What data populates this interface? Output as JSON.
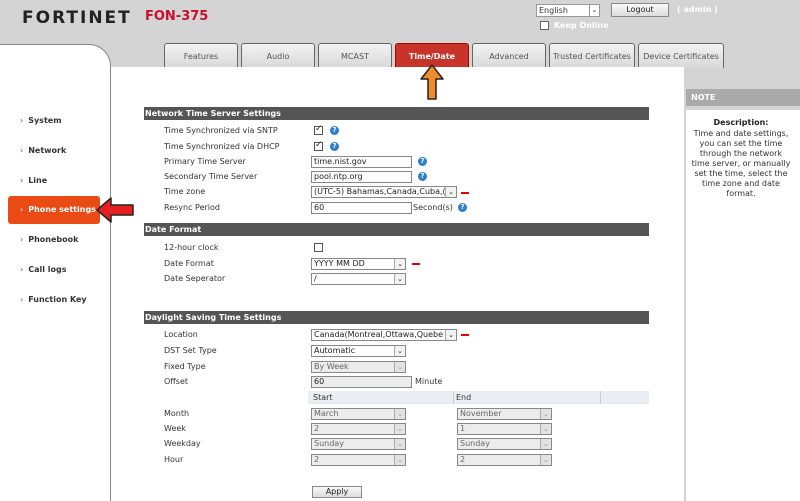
{
  "header": {
    "brand": "FORTINET",
    "model": "FON-375",
    "language": "English",
    "logout_label": "Logout",
    "user": "( admin )",
    "keep_online_label": "Keep Online"
  },
  "tabs": [
    {
      "label": "Features"
    },
    {
      "label": "Audio"
    },
    {
      "label": "MCAST"
    },
    {
      "label": "Time/Date"
    },
    {
      "label": "Advanced"
    },
    {
      "label": "Trusted Certificates"
    },
    {
      "label": "Device Certificates"
    }
  ],
  "sidebar": {
    "items": [
      {
        "label": "System"
      },
      {
        "label": "Network"
      },
      {
        "label": "Line"
      },
      {
        "label": "Phone settings"
      },
      {
        "label": "Phonebook"
      },
      {
        "label": "Call logs"
      },
      {
        "label": "Function Key"
      }
    ]
  },
  "ntp": {
    "title": "Network Time Server Settings",
    "sntp_label": "Time Synchronized via SNTP",
    "dhcp_label": "Time Synchronized via DHCP",
    "primary_label": "Primary Time Server",
    "primary_value": "time.nist.gov",
    "secondary_label": "Secondary Time Server",
    "secondary_value": "pool.ntp.org",
    "tz_label": "Time zone",
    "tz_value": "(UTC-5) Bahamas,Canada,Cuba,(",
    "resync_label": "Resync Period",
    "resync_value": "60",
    "resync_unit": "Second(s)"
  },
  "date_format": {
    "title": "Date Format",
    "clock_label": "12-hour clock",
    "format_label": "Date Format",
    "format_value": "YYYY MM DD",
    "sep_label": "Date Seperator",
    "sep_value": "/"
  },
  "dst": {
    "title": "Daylight Saving Time Settings",
    "location_label": "Location",
    "location_value": "Canada(Montreal,Ottawa,Quebe",
    "type_label": "DST Set Type",
    "type_value": "Automatic",
    "fixed_label": "Fixed Type",
    "fixed_value": "By Week",
    "offset_label": "Offset",
    "offset_value": "60",
    "offset_unit": "Minute",
    "start_label": "Start",
    "end_label": "End",
    "month_label": "Month",
    "month_start": "March",
    "month_end": "November",
    "week_label": "Week",
    "week_start": "2",
    "week_end": "1",
    "weekday_label": "Weekday",
    "weekday_start": "Sunday",
    "weekday_end": "Sunday",
    "hour_label": "Hour",
    "hour_start": "2",
    "hour_end": "2"
  },
  "apply_label": "Apply",
  "note": {
    "header": "NOTE",
    "title": "Description:",
    "text": "Time and date settings, you can set the time through the network time server, or manually set the time, select the time zone and date format."
  },
  "help_glyph": "?",
  "colors": {
    "accent": "#c8342a",
    "nav_active": "#ea4a14",
    "section": "#555555",
    "help": "#2a7fd4",
    "annotation": "#f08c2a"
  }
}
